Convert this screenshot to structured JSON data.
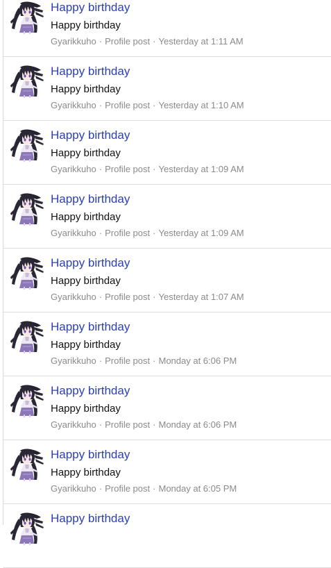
{
  "posts": [
    {
      "title": "Happy birthday",
      "body": "Happy birthday",
      "author": "Gyarikkuho",
      "type": "Profile post",
      "time": "Yesterday at 1:11 AM"
    },
    {
      "title": "Happy birthday",
      "body": "Happy birthday",
      "author": "Gyarikkuho",
      "type": "Profile post",
      "time": "Yesterday at 1:10 AM"
    },
    {
      "title": "Happy birthday",
      "body": "Happy birthday",
      "author": "Gyarikkuho",
      "type": "Profile post",
      "time": "Yesterday at 1:09 AM"
    },
    {
      "title": "Happy birthday",
      "body": "Happy birthday",
      "author": "Gyarikkuho",
      "type": "Profile post",
      "time": "Yesterday at 1:09 AM"
    },
    {
      "title": "Happy birthday",
      "body": "Happy birthday",
      "author": "Gyarikkuho",
      "type": "Profile post",
      "time": "Yesterday at 1:07 AM"
    },
    {
      "title": "Happy birthday",
      "body": "Happy birthday",
      "author": "Gyarikkuho",
      "type": "Profile post",
      "time": "Monday at 6:06 PM"
    },
    {
      "title": "Happy birthday",
      "body": "Happy birthday",
      "author": "Gyarikkuho",
      "type": "Profile post",
      "time": "Monday at 6:06 PM"
    },
    {
      "title": "Happy birthday",
      "body": "Happy birthday",
      "author": "Gyarikkuho",
      "type": "Profile post",
      "time": "Monday at 6:05 PM"
    },
    {
      "title": "Happy birthday",
      "body": "",
      "author": "",
      "type": "",
      "time": ""
    }
  ],
  "meta_separator": "·",
  "colors": {
    "title_link": "#2b3fb8",
    "meta_text": "#8a8a8a",
    "body_text": "#111111",
    "divider": "#dcdcdc"
  },
  "icons": {
    "avatar": "anime-girl-avatar-icon"
  }
}
